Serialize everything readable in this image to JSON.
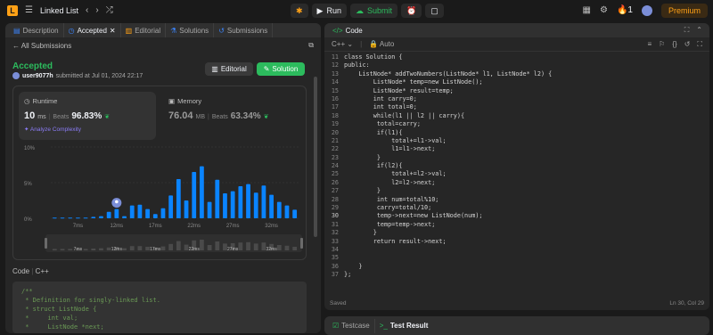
{
  "topbar": {
    "problem_list": "Linked List",
    "run": "Run",
    "submit": "Submit",
    "streak": "1",
    "premium": "Premium"
  },
  "left_tabs": [
    "Description",
    "Accepted",
    "Editorial",
    "Solutions",
    "Submissions"
  ],
  "submission": {
    "back": "All Submissions",
    "status": "Accepted",
    "user": "user9077h",
    "submitted": "submitted at Jul 01, 2024 22:17",
    "editorial_btn": "Editorial",
    "solution_btn": "Solution",
    "runtime_label": "Runtime",
    "runtime_value": "10",
    "runtime_unit": "ms",
    "runtime_beats_label": "Beats",
    "runtime_beats": "96.83%",
    "analyze": "Analyze Complexity",
    "memory_label": "Memory",
    "memory_value": "76.04",
    "memory_unit": "MB",
    "memory_beats_label": "Beats",
    "memory_beats": "63.34%"
  },
  "chart_data": {
    "type": "bar",
    "y_ticks": [
      "10%",
      "5%",
      "0%"
    ],
    "ylim": [
      0,
      10
    ],
    "x_ticks": [
      "7ms",
      "12ms",
      "17ms",
      "22ms",
      "27ms",
      "32ms"
    ],
    "values": [
      0.1,
      0.1,
      0.1,
      0.1,
      0.1,
      0.2,
      0.3,
      0.9,
      1.3,
      0.3,
      1.8,
      1.9,
      1.3,
      0.6,
      1.4,
      3.2,
      5.5,
      2.5,
      6.5,
      7.3,
      2.3,
      5.4,
      3.5,
      3.8,
      4.5,
      4.8,
      3.6,
      4.6,
      3.3,
      2.3,
      1.8,
      1.2
    ],
    "highlight_index": 8,
    "mini_values": [
      0.4,
      0.4,
      0.4,
      0.4,
      0.4,
      0.5,
      0.6,
      0.8,
      1,
      0.6,
      1.2,
      1.2,
      1,
      0.8,
      1.1,
      1.8,
      2.6,
      1.6,
      2.8,
      3,
      1.5,
      2.5,
      1.9,
      2,
      2.2,
      2.3,
      1.9,
      2.2,
      1.8,
      1.5,
      1.3,
      1
    ],
    "colors": {
      "bar": "#0a84ff",
      "grid": "#3a3a3a",
      "label": "#8a8a8a"
    }
  },
  "code_section": {
    "label_code": "Code",
    "label_lang": "C++",
    "lines": [
      "/**",
      " * Definition for singly-linked list.",
      " * struct ListNode {",
      " *     int val;",
      " *     ListNode *next;"
    ]
  },
  "editor": {
    "title": "Code",
    "language": "C++",
    "auto": "Auto",
    "status_left": "Saved",
    "status_right": "Ln 30, Col 29",
    "lines": [
      {
        "n": "11",
        "t": "class Solution {"
      },
      {
        "n": "12",
        "t": "public:"
      },
      {
        "n": "13",
        "t": "    ListNode* addTwoNumbers(ListNode* l1, ListNode* l2) {"
      },
      {
        "n": "14",
        "t": "        ListNode* temp=new ListNode();"
      },
      {
        "n": "15",
        "t": "        ListNode* result=temp;"
      },
      {
        "n": "16",
        "t": "        int carry=0;"
      },
      {
        "n": "17",
        "t": "        int total=0;"
      },
      {
        "n": "18",
        "t": "        while(l1 || l2 || carry){"
      },
      {
        "n": "19",
        "t": "         total=carry;"
      },
      {
        "n": "20",
        "t": "         if(l1){"
      },
      {
        "n": "21",
        "t": "             total+=l1->val;"
      },
      {
        "n": "22",
        "t": "             l1=l1->next;"
      },
      {
        "n": "23",
        "t": "         }"
      },
      {
        "n": "24",
        "t": "         if(l2){"
      },
      {
        "n": "25",
        "t": "             total+=l2->val;"
      },
      {
        "n": "26",
        "t": "             l2=l2->next;"
      },
      {
        "n": "27",
        "t": "         }"
      },
      {
        "n": "28",
        "t": "         int num=total%10;"
      },
      {
        "n": "29",
        "t": "         carry=total/10;"
      },
      {
        "n": "30",
        "t": "         temp->next=new ListNode(num);"
      },
      {
        "n": "31",
        "t": "         temp=temp->next;"
      },
      {
        "n": "32",
        "t": "        }"
      },
      {
        "n": "33",
        "t": "        return result->next;"
      },
      {
        "n": "34",
        "t": ""
      },
      {
        "n": "35",
        "t": ""
      },
      {
        "n": "36",
        "t": "    }"
      },
      {
        "n": "37",
        "t": "};"
      }
    ]
  },
  "bottom_tabs": [
    "Testcase",
    "Test Result"
  ]
}
